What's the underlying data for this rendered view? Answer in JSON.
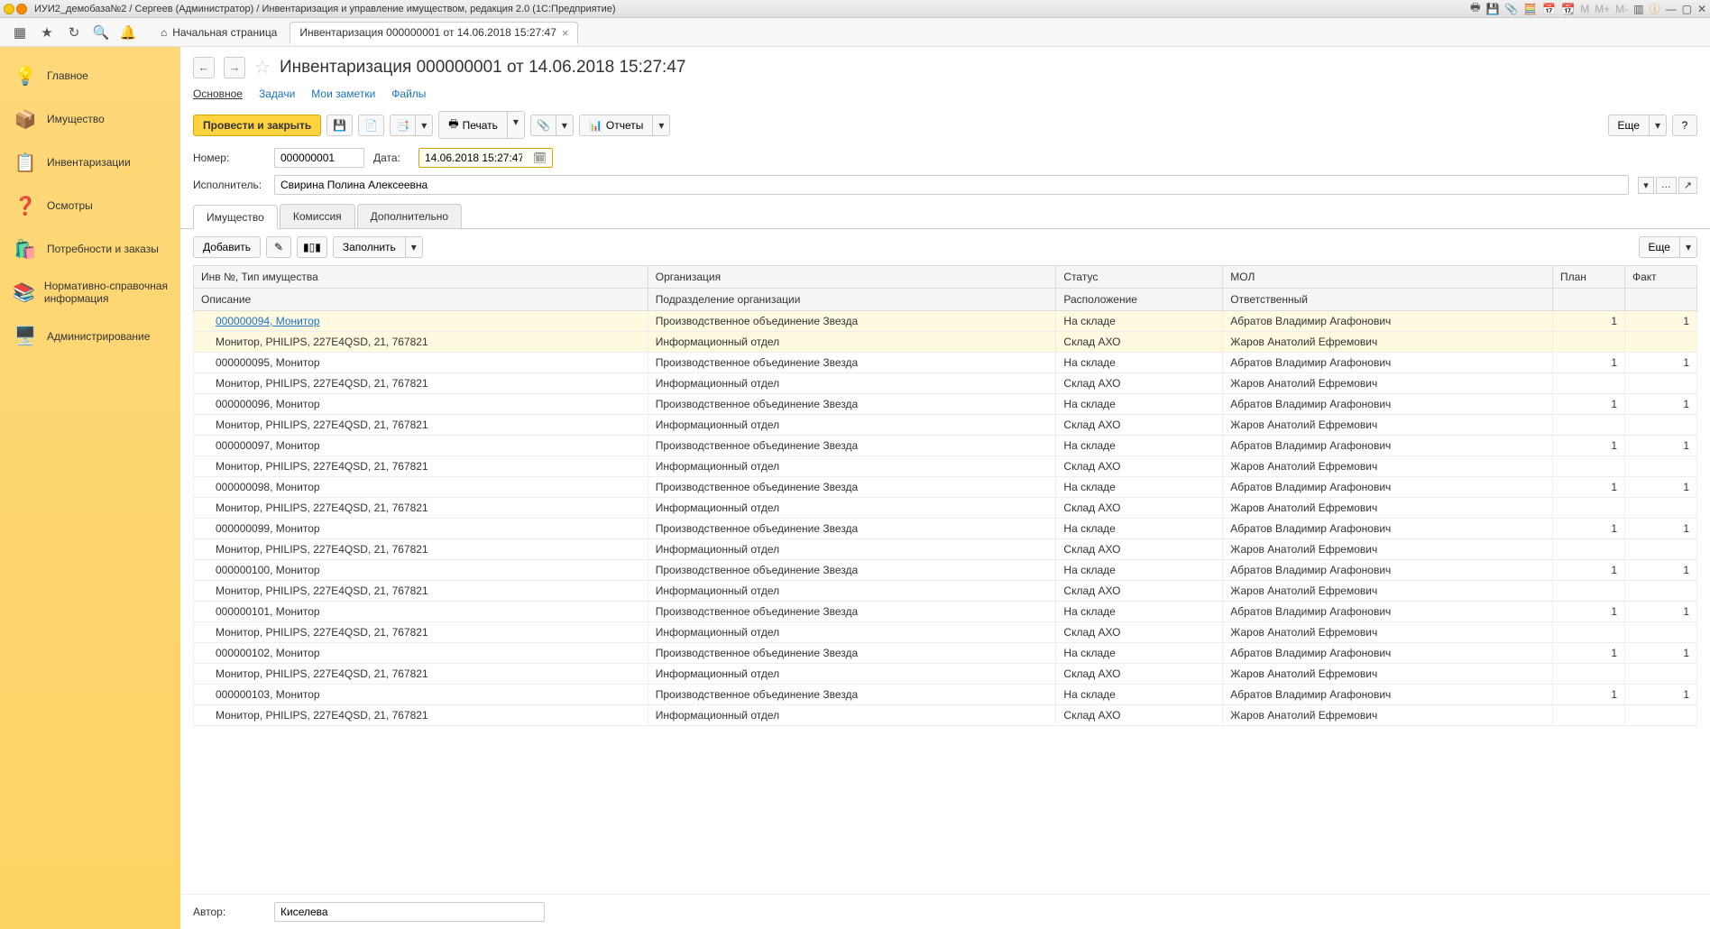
{
  "app": {
    "title": "ИУИ2_демобаза№2 / Сергеев (Администратор) / Инвентаризация и управление имуществом, редакция 2.0  (1С:Предприятие)"
  },
  "tabs": {
    "home": "Начальная страница",
    "active": "Инвентаризация 000000001 от 14.06.2018 15:27:47"
  },
  "sidebar": {
    "items": [
      {
        "label": "Главное",
        "icon": "💡"
      },
      {
        "label": "Имущество",
        "icon": "📦"
      },
      {
        "label": "Инвентаризации",
        "icon": "📋"
      },
      {
        "label": "Осмотры",
        "icon": "❓"
      },
      {
        "label": "Потребности и заказы",
        "icon": "🛍️"
      },
      {
        "label": "Нормативно-справочная информация",
        "icon": "📚"
      },
      {
        "label": "Администрирование",
        "icon": "🖥️"
      }
    ]
  },
  "doc": {
    "title": "Инвентаризация 000000001 от 14.06.2018 15:27:47",
    "subtabs": {
      "main": "Основное",
      "tasks": "Задачи",
      "notes": "Мои заметки",
      "files": "Файлы"
    },
    "actions": {
      "confirm": "Провести и закрыть",
      "print": "Печать",
      "reports": "Отчеты",
      "more": "Еще",
      "help": "?"
    },
    "fields": {
      "number_label": "Номер:",
      "number": "000000001",
      "date_label": "Дата:",
      "date": "14.06.2018 15:27:47",
      "executor_label": "Исполнитель:",
      "executor": "Свирина Полина Алексеевна",
      "author_label": "Автор:",
      "author": "Киселева"
    },
    "content_tabs": {
      "assets": "Имущество",
      "commission": "Комиссия",
      "extra": "Дополнительно"
    },
    "table_actions": {
      "add": "Добавить",
      "fill": "Заполнить",
      "more": "Еще"
    }
  },
  "table": {
    "headers": {
      "inv": "Инв №, Тип имущества",
      "org": "Организация",
      "status": "Статус",
      "mol": "МОЛ",
      "plan": "План",
      "fact": "Факт",
      "desc": "Описание",
      "dept": "Подразделение организации",
      "loc": "Расположение",
      "resp": "Ответственный"
    },
    "rows": [
      {
        "inv": "000000094, Монитор",
        "org": "Производственное объединение Звезда",
        "status": "На складе",
        "mol": "Абратов Владимир Агафонович",
        "plan": "1",
        "fact": "1",
        "desc": "Монитор, PHILIPS, 227E4QSD, 21, 767821",
        "dept": "Информационный отдел",
        "loc": "Склад АХО",
        "resp": "Жаров Анатолий Ефремович",
        "sel": true
      },
      {
        "inv": "000000095, Монитор",
        "org": "Производственное объединение Звезда",
        "status": "На складе",
        "mol": "Абратов Владимир Агафонович",
        "plan": "1",
        "fact": "1",
        "desc": "Монитор, PHILIPS, 227E4QSD, 21, 767821",
        "dept": "Информационный отдел",
        "loc": "Склад АХО",
        "resp": "Жаров Анатолий Ефремович"
      },
      {
        "inv": "000000096, Монитор",
        "org": "Производственное объединение Звезда",
        "status": "На складе",
        "mol": "Абратов Владимир Агафонович",
        "plan": "1",
        "fact": "1",
        "desc": "Монитор, PHILIPS, 227E4QSD, 21, 767821",
        "dept": "Информационный отдел",
        "loc": "Склад АХО",
        "resp": "Жаров Анатолий Ефремович"
      },
      {
        "inv": "000000097, Монитор",
        "org": "Производственное объединение Звезда",
        "status": "На складе",
        "mol": "Абратов Владимир Агафонович",
        "plan": "1",
        "fact": "1",
        "desc": "Монитор, PHILIPS, 227E4QSD, 21, 767821",
        "dept": "Информационный отдел",
        "loc": "Склад АХО",
        "resp": "Жаров Анатолий Ефремович"
      },
      {
        "inv": "000000098, Монитор",
        "org": "Производственное объединение Звезда",
        "status": "На складе",
        "mol": "Абратов Владимир Агафонович",
        "plan": "1",
        "fact": "1",
        "desc": "Монитор, PHILIPS, 227E4QSD, 21, 767821",
        "dept": "Информационный отдел",
        "loc": "Склад АХО",
        "resp": "Жаров Анатолий Ефремович"
      },
      {
        "inv": "000000099, Монитор",
        "org": "Производственное объединение Звезда",
        "status": "На складе",
        "mol": "Абратов Владимир Агафонович",
        "plan": "1",
        "fact": "1",
        "desc": "Монитор, PHILIPS, 227E4QSD, 21, 767821",
        "dept": "Информационный отдел",
        "loc": "Склад АХО",
        "resp": "Жаров Анатолий Ефремович"
      },
      {
        "inv": "000000100, Монитор",
        "org": "Производственное объединение Звезда",
        "status": "На складе",
        "mol": "Абратов Владимир Агафонович",
        "plan": "1",
        "fact": "1",
        "desc": "Монитор, PHILIPS, 227E4QSD, 21, 767821",
        "dept": "Информационный отдел",
        "loc": "Склад АХО",
        "resp": "Жаров Анатолий Ефремович"
      },
      {
        "inv": "000000101, Монитор",
        "org": "Производственное объединение Звезда",
        "status": "На складе",
        "mol": "Абратов Владимир Агафонович",
        "plan": "1",
        "fact": "1",
        "desc": "Монитор, PHILIPS, 227E4QSD, 21, 767821",
        "dept": "Информационный отдел",
        "loc": "Склад АХО",
        "resp": "Жаров Анатолий Ефремович"
      },
      {
        "inv": "000000102, Монитор",
        "org": "Производственное объединение Звезда",
        "status": "На складе",
        "mol": "Абратов Владимир Агафонович",
        "plan": "1",
        "fact": "1",
        "desc": "Монитор, PHILIPS, 227E4QSD, 21, 767821",
        "dept": "Информационный отдел",
        "loc": "Склад АХО",
        "resp": "Жаров Анатолий Ефремович"
      },
      {
        "inv": "000000103, Монитор",
        "org": "Производственное объединение Звезда",
        "status": "На складе",
        "mol": "Абратов Владимир Агафонович",
        "plan": "1",
        "fact": "1",
        "desc": "Монитор, PHILIPS, 227E4QSD, 21, 767821",
        "dept": "Информационный отдел",
        "loc": "Склад АХО",
        "resp": "Жаров Анатолий Ефремович"
      }
    ]
  }
}
